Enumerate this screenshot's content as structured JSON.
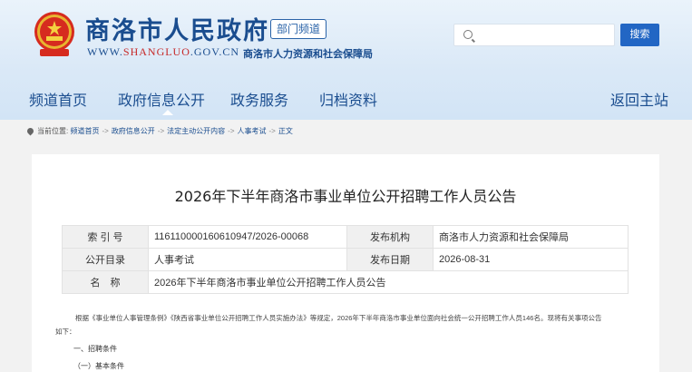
{
  "header": {
    "site_title": "商洛市人民政府",
    "dept_badge": "部门频道",
    "url_prefix": "WWW.",
    "url_domain": "SHANGLUO",
    "url_suffix": ".GOV.CN",
    "subtitle": "商洛市人力资源和社会保障局",
    "search_placeholder": "",
    "search_button": "搜索"
  },
  "nav": {
    "items": [
      "频道首页",
      "政府信息公开",
      "政务服务",
      "归档资料"
    ],
    "return_link": "返回主站",
    "active_index": 1
  },
  "breadcrumb": {
    "prefix": "当前位置:",
    "items": [
      "频道首页",
      "政府信息公开",
      "法定主动公开内容",
      "人事考试",
      "正文"
    ],
    "separator": "->"
  },
  "article": {
    "title": "2026年下半年商洛市事业单位公开招聘工作人员公告",
    "meta": {
      "index_label": "索 引 号",
      "index_value": "116110000160610947/2026-00068",
      "publisher_label": "发布机构",
      "publisher_value": "商洛市人力资源和社会保障局",
      "category_label": "公开目录",
      "category_value": "人事考试",
      "date_label": "发布日期",
      "date_value": "2026-08-31",
      "name_label": "名　称",
      "name_value": "2026年下半年商洛市事业单位公开招聘工作人员公告"
    },
    "paragraph1": "根据《事业单位人事管理条例》《陕西省事业单位公开招聘工作人员实施办法》等规定，2026年下半年商洛市事业单位面向社会统一公开招聘工作人员146名。现将有关事项公告",
    "paragraph1_cont": "如下：",
    "section1": "一、招聘条件",
    "section2": "（一）基本条件"
  },
  "colors": {
    "brand_blue": "#1a4d8f",
    "button_blue": "#2266c4",
    "url_red": "#c62828"
  }
}
